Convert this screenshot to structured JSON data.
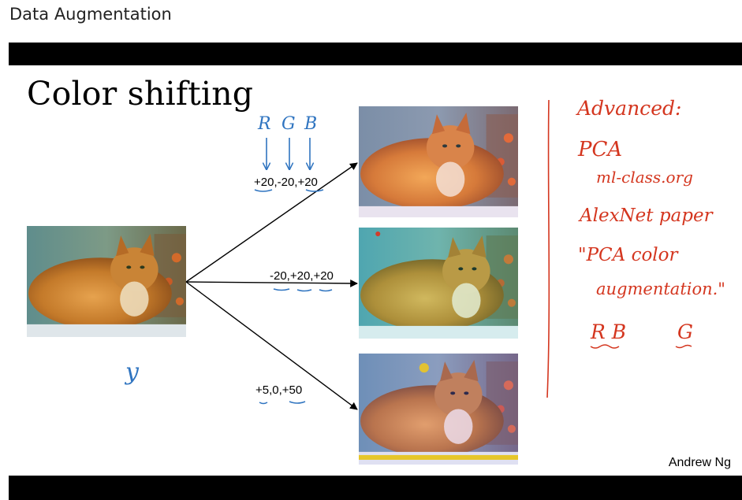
{
  "header": {
    "title": "Data Augmentation"
  },
  "slide": {
    "heading": "Color shifting",
    "credit": "Andrew Ng",
    "shift_labels": [
      "+20,-20,+20",
      "-20,+20,+20",
      "+5,0,+50"
    ],
    "handwritten_blue": {
      "channels": [
        "R",
        "G",
        "B"
      ],
      "target": "y"
    },
    "handwritten_red": {
      "advanced": "Advanced:",
      "pca": "PCA",
      "ml_class": "ml-class.org",
      "alexnet": "AlexNet paper",
      "pca_color": "\"PCA color",
      "augmentation": "augmentation.\"",
      "rb": "R B",
      "g": "G"
    }
  },
  "colors": {
    "bar": "#000000",
    "ink_red": "#d4361f",
    "ink_blue": "#2f74c0"
  },
  "images": [
    {
      "name": "original-cat-photo",
      "tint": "original"
    },
    {
      "name": "shifted-cat-photo-1",
      "tint": "+20,-20,+20"
    },
    {
      "name": "shifted-cat-photo-2",
      "tint": "-20,+20,+20"
    },
    {
      "name": "shifted-cat-photo-3",
      "tint": "+5,0,+50"
    }
  ]
}
